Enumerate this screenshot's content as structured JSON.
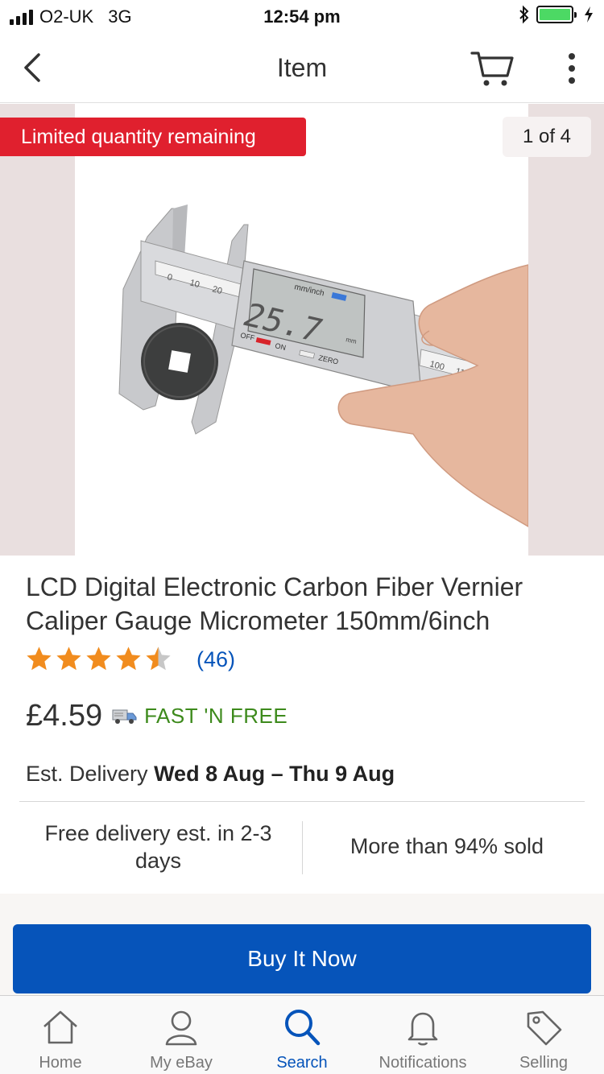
{
  "status_bar": {
    "carrier": "O2-UK",
    "network": "3G",
    "time": "12:54 pm",
    "icons": [
      "signal-icon",
      "bluetooth-icon",
      "battery-icon",
      "charging-icon"
    ]
  },
  "nav": {
    "title": "Item",
    "icons": [
      "chevron-left-icon",
      "cart-icon",
      "more-vertical-icon"
    ]
  },
  "gallery": {
    "badge": "Limited quantity remaining",
    "counter": "1 of 4",
    "display_mm": "25.7",
    "scale_top": [
      "0",
      "10",
      "20"
    ],
    "scale_right": [
      "100",
      "110"
    ],
    "unit_label": "mm/inch",
    "off_label": "OFF",
    "on_label": "ON",
    "zero_label": "ZERO",
    "mm_label": "mm"
  },
  "product": {
    "title": "LCD Digital Electronic Carbon Fiber Vernier Caliper Gauge Micrometer 150mm/6inch",
    "rating": 4.5,
    "review_count": "(46)",
    "price": "£4.59",
    "shipping": "FAST 'N FREE",
    "delivery_label": "Est. Delivery",
    "delivery_dates": "Wed 8 Aug – Thu 9 Aug",
    "info_left": "Free delivery est. in 2-3 days",
    "info_right": "More than 94% sold",
    "buy_button": "Buy It Now"
  },
  "colors": {
    "accent": "#0654ba",
    "badge_red": "#e0202e",
    "star": "#f18c1e",
    "shipping_green": "#3d8a1c"
  },
  "tabs": [
    {
      "label": "Home",
      "icon": "home-icon",
      "active": false
    },
    {
      "label": "My eBay",
      "icon": "user-icon",
      "active": false
    },
    {
      "label": "Search",
      "icon": "search-icon",
      "active": true
    },
    {
      "label": "Notifications",
      "icon": "bell-icon",
      "active": false
    },
    {
      "label": "Selling",
      "icon": "tag-icon",
      "active": false
    }
  ]
}
